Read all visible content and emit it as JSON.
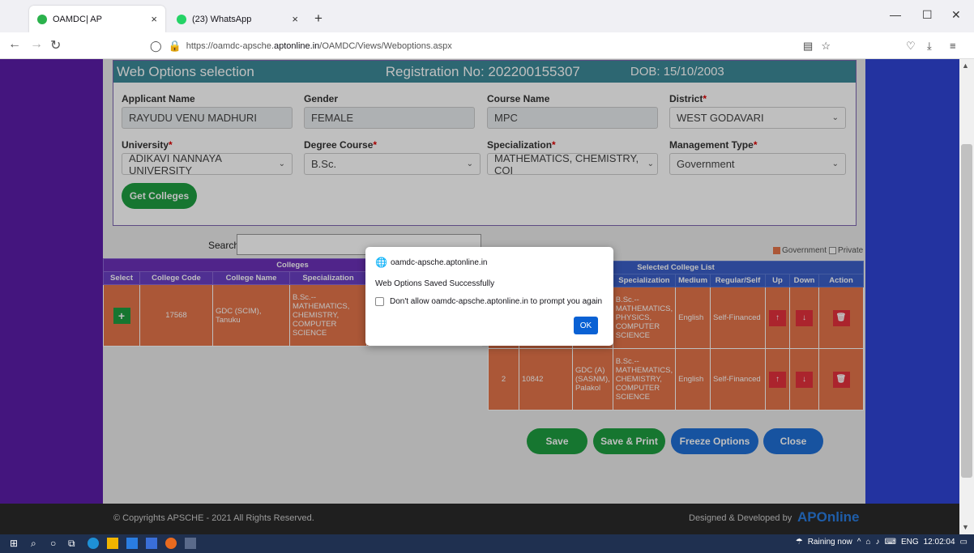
{
  "browser": {
    "tabs": [
      {
        "label": "OAMDC| AP",
        "favicon_color": "#2bb24c"
      },
      {
        "label": "(23) WhatsApp",
        "favicon_color": "#25d366"
      }
    ],
    "url_prefix": "https://oamdc-apsche.",
    "url_domain": "aptonline.in",
    "url_path": "/OAMDC/Views/Weboptions.aspx"
  },
  "form": {
    "title": "Web Options selection",
    "registration": "Registration No: 202200155307",
    "dob": "DOB: 15/10/2003",
    "applicant_label": "Applicant Name",
    "applicant_value": "RAYUDU VENU MADHURI",
    "gender_label": "Gender",
    "gender_value": "FEMALE",
    "course_label": "Course Name",
    "course_value": "MPC",
    "district_label": "District",
    "district_value": "WEST GODAVARI",
    "university_label": "University",
    "university_value": "ADIKAVI NANNAYA UNIVERSITY",
    "degree_label": "Degree Course",
    "degree_value": "B.Sc.",
    "specialization_label": "Specialization",
    "specialization_value": "MATHEMATICS, CHEMISTRY, COI",
    "management_label": "Management Type",
    "management_value": "Government",
    "get_colleges": "Get Colleges",
    "required_mark": "*"
  },
  "search": {
    "label": "Search:",
    "value": ""
  },
  "legend": {
    "government": "Government",
    "private": "Private",
    "gov_color": "#e5754a"
  },
  "colleges_table": {
    "title": "Colleges",
    "headers": [
      "Select",
      "College Code",
      "College Name",
      "Specialization"
    ],
    "rows": [
      {
        "select": "+",
        "code": "17568",
        "name": "GDC (SCIM), Tanuku",
        "specialization": "B.Sc.-- MATHEMATICS, CHEMISTRY, COMPUTER SCIENCE"
      }
    ]
  },
  "selected_table": {
    "title": "Selected College List",
    "headers": [
      "ame",
      "Specialization",
      "Medium",
      "Regular/Self",
      "Up",
      "Down",
      "Action"
    ],
    "rows": [
      {
        "num": "",
        "code": "",
        "name": ")",
        "specialization": "B.Sc.-- MATHEMATICS, PHYSICS, COMPUTER SCIENCE",
        "medium": "English",
        "type": "Self-Financed"
      },
      {
        "num": "2",
        "code": "10842",
        "name": "GDC (A)(SASNM), Palakol",
        "specialization": "B.Sc.-- MATHEMATICS, CHEMISTRY, COMPUTER SCIENCE",
        "medium": "English",
        "type": "Self-Financed"
      }
    ],
    "up_icon": "↑",
    "down_icon": "↓",
    "delete_icon": "🗑"
  },
  "buttons": {
    "save": "Save",
    "save_print": "Save & Print",
    "freeze": "Freeze Options",
    "close": "Close"
  },
  "footer": {
    "copyright": "© Copyrights APSCHE - 2021 All Rights Reserved.",
    "designed": "Designed & Developed by",
    "brand": "APOnline"
  },
  "dialog": {
    "origin": "oamdc-apsche.aptonline.in",
    "message": "Web Options Saved Successfully",
    "checkbox_label": "Don't allow oamdc-apsche.aptonline.in to prompt you again",
    "ok": "OK"
  },
  "taskbar": {
    "weather": "Raining now",
    "lang": "ENG",
    "time": "12:02:04"
  }
}
